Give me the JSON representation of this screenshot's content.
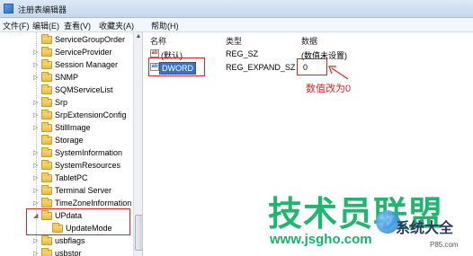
{
  "window": {
    "title": "注册表编辑器"
  },
  "menu": [
    "文件(F)",
    "编辑(E)",
    "查看(V)",
    "收藏夹(A)",
    "帮助(H)"
  ],
  "tree": {
    "items": [
      {
        "label": "ServiceGroupOrder"
      },
      {
        "label": "ServiceProvider"
      },
      {
        "label": "Session Manager"
      },
      {
        "label": "SNMP"
      },
      {
        "label": "SQMServiceList"
      },
      {
        "label": "Srp"
      },
      {
        "label": "SrpExtensionConfig"
      },
      {
        "label": "StillImage"
      },
      {
        "label": "Storage"
      },
      {
        "label": "SystemInformation"
      },
      {
        "label": "SystemResources"
      },
      {
        "label": "TabletPC"
      },
      {
        "label": "Terminal Server"
      },
      {
        "label": "TimeZoneInformation"
      },
      {
        "label": "UPdata"
      },
      {
        "label": "UpdateMode"
      },
      {
        "label": "usbflags"
      },
      {
        "label": "usbstor"
      }
    ]
  },
  "list": {
    "headers": {
      "name": "名称",
      "type": "类型",
      "data": "数据"
    },
    "rows": [
      {
        "icon": "string-value-icon",
        "glyph": "ab",
        "name": "(默认)",
        "type": "REG_SZ",
        "data": "(数值未设置)"
      },
      {
        "icon": "binary-value-icon",
        "glyph": "ab",
        "name": "DWORD",
        "type": "REG_EXPAND_SZ",
        "data": "0"
      }
    ]
  },
  "annotation": {
    "text": "数值改为0",
    "color": "#e02020"
  },
  "watermark": {
    "main": "技术员联盟",
    "url": "www.jsgho.com",
    "side": "系统大全",
    "small": "P85.com"
  },
  "colors": {
    "selection": "#3a73c6",
    "highlight": "#e02020",
    "watermark": "#17b26a"
  }
}
